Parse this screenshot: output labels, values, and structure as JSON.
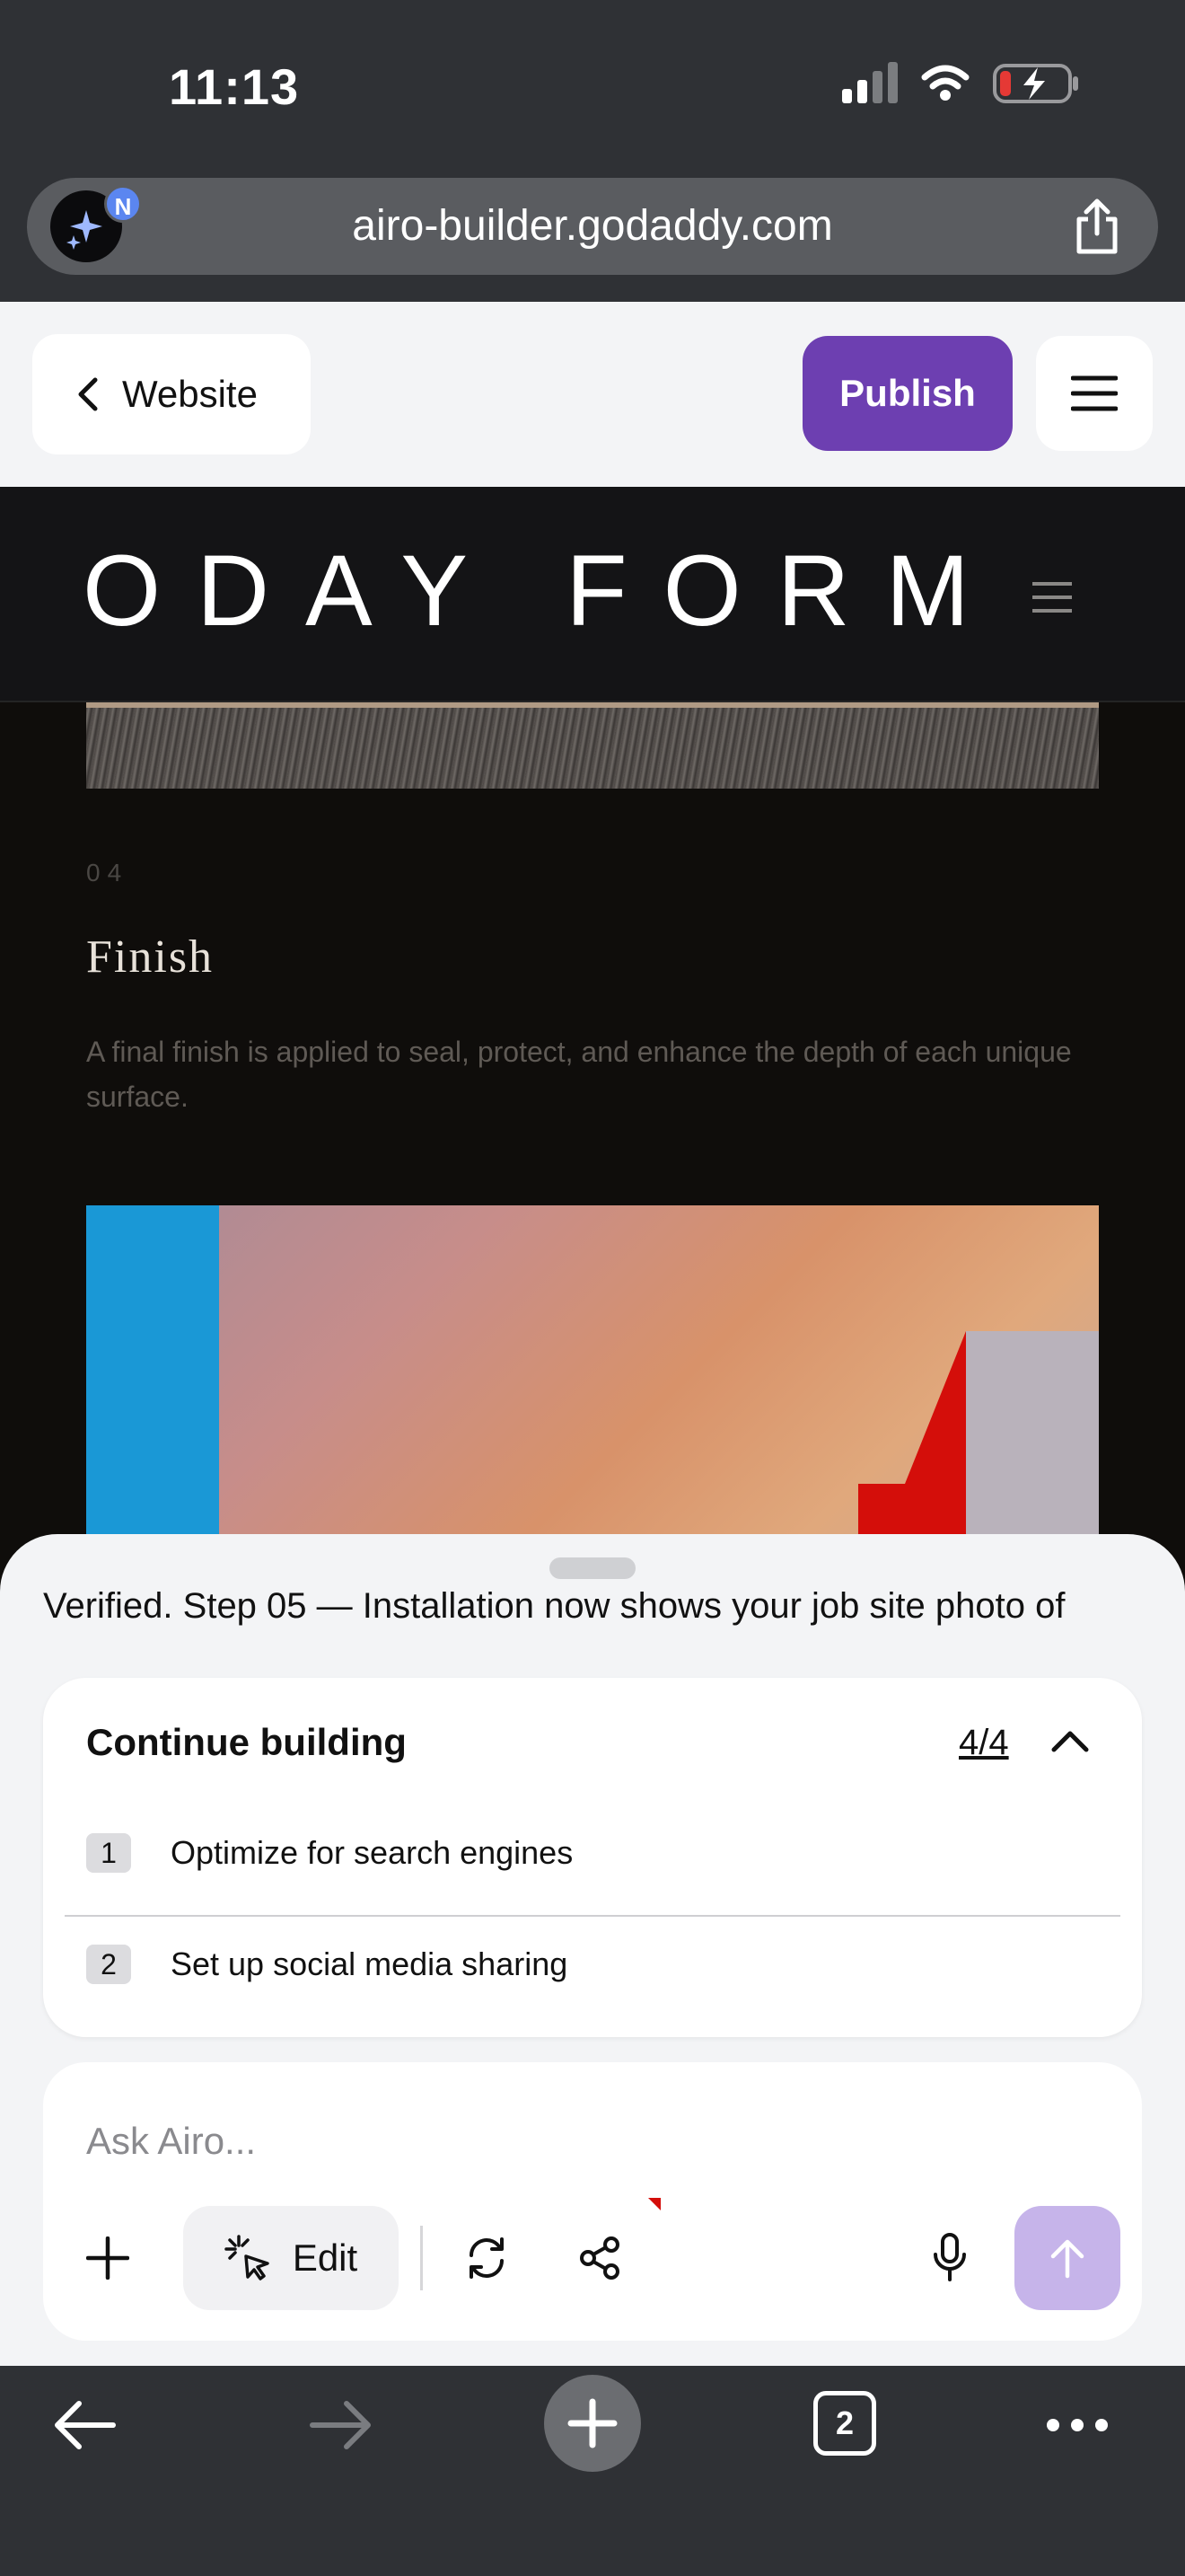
{
  "status_bar": {
    "time": "11:13"
  },
  "browser": {
    "url": "airo-builder.godaddy.com",
    "airo_badge": "N",
    "tab_count": "2"
  },
  "editor": {
    "back_label": "Website",
    "publish_label": "Publish"
  },
  "site": {
    "logo_text": "ODAY FORM",
    "step_number": "04",
    "step_title": "Finish",
    "step_description": "A final finish is applied to seal, protect, and enhance the depth of each unique surface."
  },
  "chat": {
    "message": "Verified. Step 05 — Installation now shows your job site photo of",
    "continue": {
      "title": "Continue building",
      "count": "4/4",
      "items": [
        {
          "number": "1",
          "label": "Optimize for search engines"
        },
        {
          "number": "2",
          "label": "Set up social media sharing"
        }
      ]
    },
    "input_placeholder": "Ask Airo...",
    "edit_label": "Edit"
  },
  "colors": {
    "publish": "#6d3fb1",
    "send_button": "#c6b4ea",
    "browser_chrome": "#2f3135"
  },
  "icons": [
    "signal-icon",
    "wifi-icon",
    "battery-charging-icon",
    "share-icon",
    "chevron-left-icon",
    "hamburger-menu-icon",
    "chevron-up-icon",
    "plus-icon",
    "cursor-sparkle-icon",
    "refresh-icon",
    "share-nodes-icon",
    "microphone-icon",
    "arrow-up-icon",
    "back-arrow-icon",
    "forward-arrow-icon",
    "more-icon"
  ]
}
